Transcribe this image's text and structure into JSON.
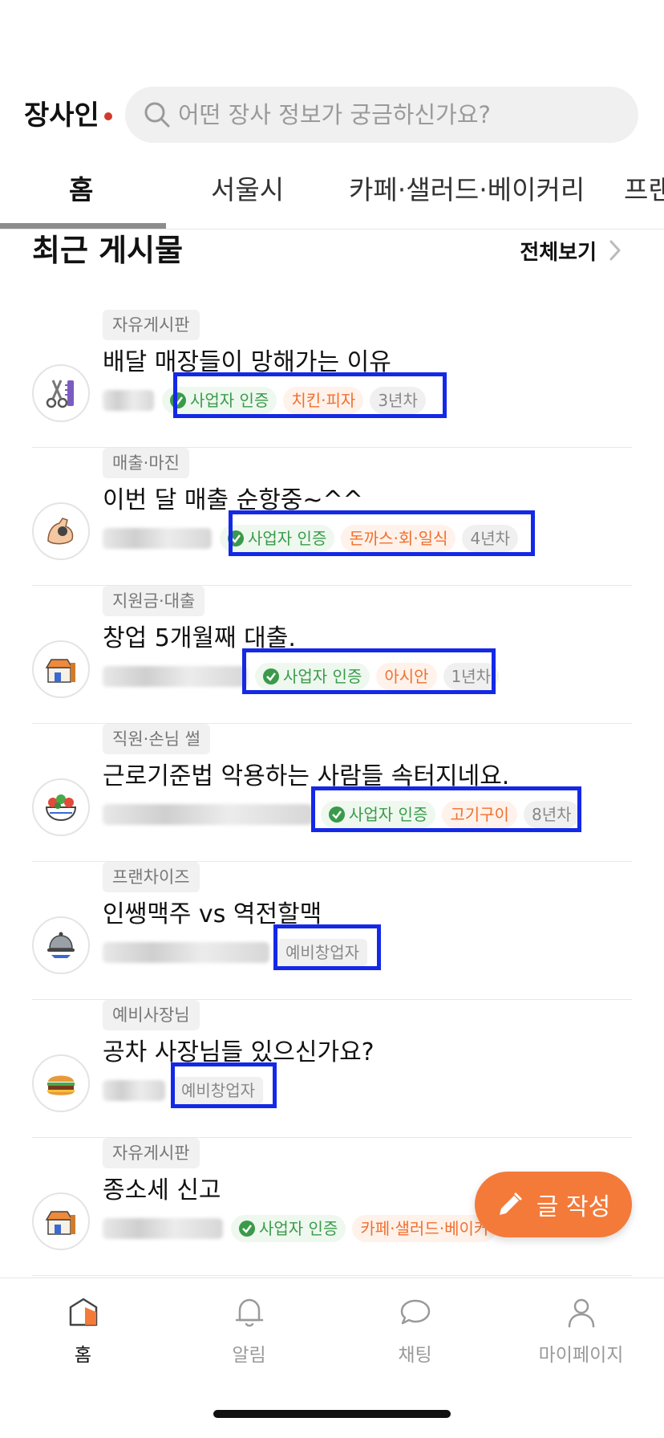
{
  "header": {
    "logo_text": "장사인",
    "search_placeholder": "어떤 장사 정보가 궁금하신가요?"
  },
  "tabs": [
    {
      "label": "홈"
    },
    {
      "label": "서울시"
    },
    {
      "label": "카페·샐러드·베이커리"
    },
    {
      "label": "프랜"
    }
  ],
  "section": {
    "title": "최근 게시물",
    "see_all": "전체보기"
  },
  "posts": [
    {
      "category": "자유게시판",
      "title": "배달 매장들이 망해가는 이유",
      "verified": "사업자 인증",
      "business": "치킨·피자",
      "years": "3년차",
      "avatar": "scissors-comb-icon"
    },
    {
      "category": "매출·마진",
      "title": "이번 달 매출 순항중~^^",
      "verified": "사업자 인증",
      "business": "돈까스·회·일식",
      "years": "4년차",
      "avatar": "muscle-arm-icon"
    },
    {
      "category": "지원금·대출",
      "title": "창업 5개월째 대출.",
      "verified": "사업자 인증",
      "business": "아시안",
      "years": "1년차",
      "avatar": "store-icon"
    },
    {
      "category": "직원·손님 썰",
      "title": "근로기준법 악용하는 사람들 속터지네요.",
      "verified": "사업자 인증",
      "business": "고기구이",
      "years": "8년차",
      "avatar": "salad-bowl-icon"
    },
    {
      "category": "프랜차이즈",
      "title": "인쌩맥주 vs  역전할맥",
      "pre_founder": "예비창업자",
      "avatar": "cloche-icon"
    },
    {
      "category": "예비사장님",
      "title": "공차 사장님들 있으신가요?",
      "pre_founder": "예비창업자",
      "avatar": "burger-icon"
    },
    {
      "category": "자유게시판",
      "title": "종소세 신고",
      "verified": "사업자 인증",
      "business": "카페·샐러드·베이커",
      "avatar": "store-icon"
    }
  ],
  "fab": {
    "label": "글 작성"
  },
  "bottom_nav": [
    {
      "label": "홈"
    },
    {
      "label": "알림"
    },
    {
      "label": "채팅"
    },
    {
      "label": "마이페이지"
    }
  ],
  "colors": {
    "accent": "#f47a3a",
    "verified_green": "#3a9a4a",
    "highlight_blue": "#1428e8"
  }
}
